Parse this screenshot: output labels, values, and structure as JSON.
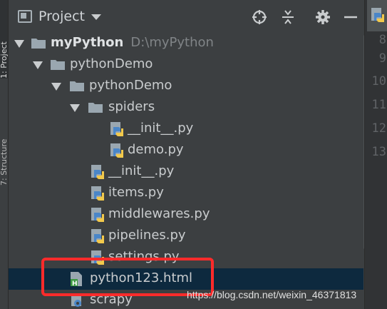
{
  "side_tabs": {
    "project": "1: Project",
    "structure": "7: Structure"
  },
  "header": {
    "title": "Project"
  },
  "tree": [
    {
      "label": "myPython",
      "path": "D:\\myPython",
      "type": "folder",
      "expanded": true,
      "bold": true
    },
    {
      "label": "pythonDemo",
      "type": "folder",
      "expanded": true
    },
    {
      "label": "pythonDemo",
      "type": "folder",
      "expanded": true
    },
    {
      "label": "spiders",
      "type": "folder",
      "expanded": true
    },
    {
      "label": "__init__.py",
      "type": "python"
    },
    {
      "label": "demo.py",
      "type": "python"
    },
    {
      "label": "__init__.py",
      "type": "python"
    },
    {
      "label": "items.py",
      "type": "python"
    },
    {
      "label": "middlewares.py",
      "type": "python"
    },
    {
      "label": "pipelines.py",
      "type": "python"
    },
    {
      "label": "settings.py",
      "type": "python"
    },
    {
      "label": "python123.html",
      "type": "html",
      "selected": true
    },
    {
      "label": "scrapy",
      "type": "config"
    }
  ],
  "line_numbers": [
    "8",
    "9",
    "10",
    "11",
    "12",
    "13"
  ],
  "watermark": "https://blog.csdn.net/weixin_46371813",
  "colors": {
    "background": "#3c3f41",
    "selection": "#0d293e",
    "highlight": "#ff2b2b",
    "python_blue": "#4a86c8",
    "python_yellow": "#f2c94c"
  }
}
